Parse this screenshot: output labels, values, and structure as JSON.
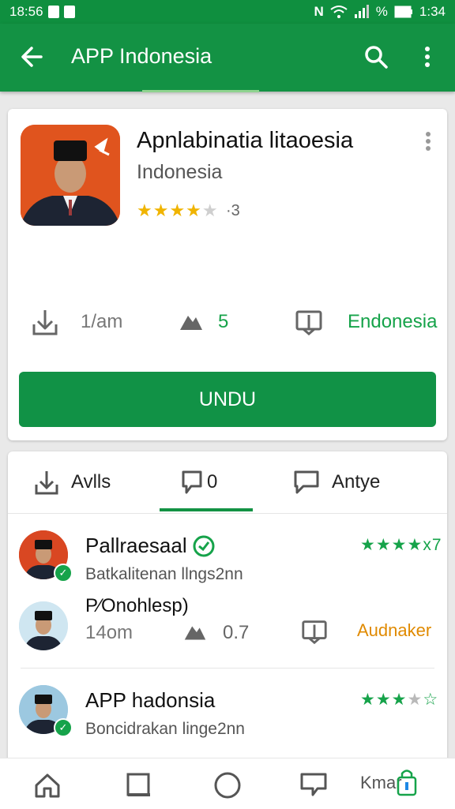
{
  "status_bar": {
    "left_text": "18:56",
    "network": "N",
    "battery_text": "%",
    "time": "1:34"
  },
  "app_bar": {
    "title": "APP Indonesia",
    "icons": [
      "back-arrow-icon",
      "search-icon",
      "more-vert-icon"
    ]
  },
  "app": {
    "name": "Apnlabinatia litaoesia",
    "developer": "Indonesia",
    "rating_stars": 4,
    "rating_value": "·3",
    "stats": [
      {
        "icon": "download-icon",
        "value": "1/am"
      },
      {
        "icon": "rocket-icon",
        "value": "5"
      },
      {
        "icon": "category-icon",
        "value": "Endonesia"
      }
    ],
    "install_label": "UNDU"
  },
  "reviews": {
    "tabs": [
      {
        "icon": "download-icon",
        "label": "Avlls"
      },
      {
        "icon": "comment-icon",
        "label": "0"
      },
      {
        "icon": "chat-icon",
        "label": "Antye"
      }
    ],
    "active_tab": 1,
    "items": [
      {
        "name": "Pallraesaal",
        "subtitle": "Batkalitenan llngs2nn",
        "stars": 4,
        "stars_suffix": "x7",
        "verified": true
      },
      {
        "name": "P⁄Onohlesp)",
        "stats": [
          {
            "icon": "download-icon",
            "value": "14om"
          },
          {
            "icon": "rocket-icon",
            "value": "0.7"
          },
          {
            "icon": "chat-icon",
            "value": "Audnaker"
          }
        ]
      },
      {
        "name": "APP hadonsia",
        "subtitle": "Boncidrakan linge2nn",
        "stars": 3,
        "stars_suffix": "☆",
        "verified": true
      }
    ]
  },
  "bottom_nav": {
    "items": [
      "home-icon",
      "apps-icon",
      "circle-icon",
      "chat-icon"
    ],
    "last_label": "Kmar"
  },
  "colors": {
    "primary": "#139244",
    "accent_green": "#16a34a",
    "star_yellow": "#f0b400",
    "orange_text": "#e08a00",
    "app_icon_bg": "#e0541e"
  }
}
